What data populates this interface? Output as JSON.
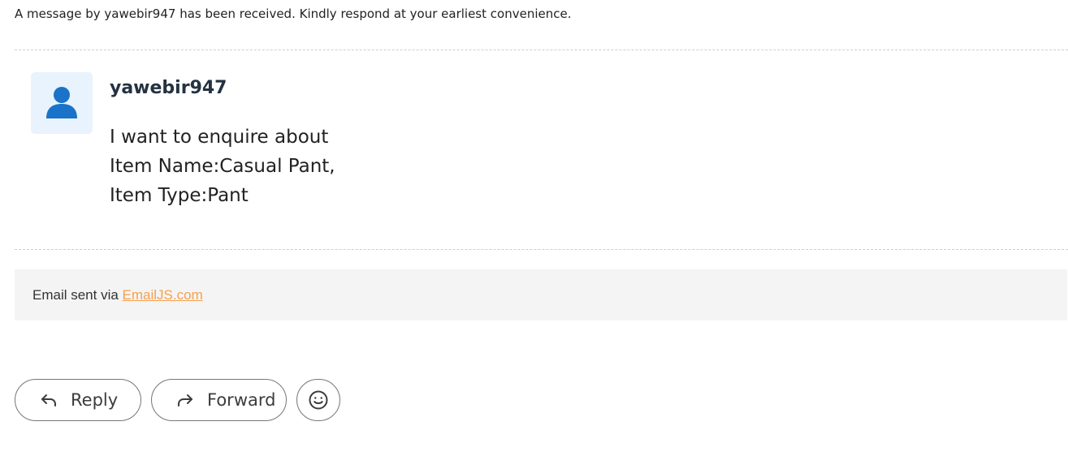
{
  "notice": "A message by yawebir947 has been received. Kindly respond at your earliest convenience.",
  "message": {
    "sender": "yawebir947",
    "avatar_icon": "person-icon",
    "lines": [
      "I want to enquire about",
      "Item Name:Casual Pant,",
      "Item Type:Pant"
    ]
  },
  "footer": {
    "prefix": "Email sent via ",
    "link_text": "EmailJS.com",
    "link_color": "#f5a04d"
  },
  "actions": {
    "reply_label": "Reply",
    "reply_icon": "reply-arrow-icon",
    "forward_label": "Forward",
    "forward_icon": "forward-arrow-icon",
    "emoji_icon": "smiley-icon"
  }
}
